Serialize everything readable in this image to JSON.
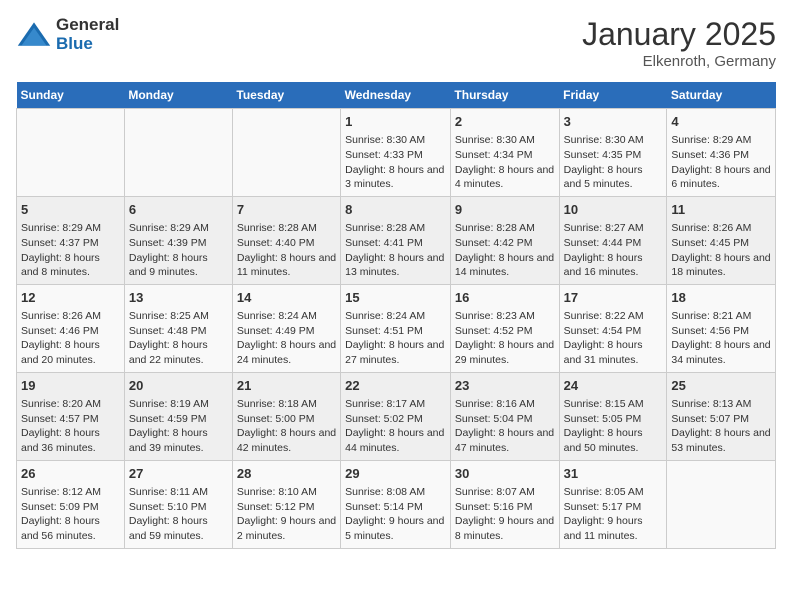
{
  "logo": {
    "general": "General",
    "blue": "Blue"
  },
  "title": "January 2025",
  "subtitle": "Elkenroth, Germany",
  "headers": [
    "Sunday",
    "Monday",
    "Tuesday",
    "Wednesday",
    "Thursday",
    "Friday",
    "Saturday"
  ],
  "rows": [
    [
      {
        "day": "",
        "content": ""
      },
      {
        "day": "",
        "content": ""
      },
      {
        "day": "",
        "content": ""
      },
      {
        "day": "1",
        "content": "Sunrise: 8:30 AM\nSunset: 4:33 PM\nDaylight: 8 hours and 3 minutes."
      },
      {
        "day": "2",
        "content": "Sunrise: 8:30 AM\nSunset: 4:34 PM\nDaylight: 8 hours and 4 minutes."
      },
      {
        "day": "3",
        "content": "Sunrise: 8:30 AM\nSunset: 4:35 PM\nDaylight: 8 hours and 5 minutes."
      },
      {
        "day": "4",
        "content": "Sunrise: 8:29 AM\nSunset: 4:36 PM\nDaylight: 8 hours and 6 minutes."
      }
    ],
    [
      {
        "day": "5",
        "content": "Sunrise: 8:29 AM\nSunset: 4:37 PM\nDaylight: 8 hours and 8 minutes."
      },
      {
        "day": "6",
        "content": "Sunrise: 8:29 AM\nSunset: 4:39 PM\nDaylight: 8 hours and 9 minutes."
      },
      {
        "day": "7",
        "content": "Sunrise: 8:28 AM\nSunset: 4:40 PM\nDaylight: 8 hours and 11 minutes."
      },
      {
        "day": "8",
        "content": "Sunrise: 8:28 AM\nSunset: 4:41 PM\nDaylight: 8 hours and 13 minutes."
      },
      {
        "day": "9",
        "content": "Sunrise: 8:28 AM\nSunset: 4:42 PM\nDaylight: 8 hours and 14 minutes."
      },
      {
        "day": "10",
        "content": "Sunrise: 8:27 AM\nSunset: 4:44 PM\nDaylight: 8 hours and 16 minutes."
      },
      {
        "day": "11",
        "content": "Sunrise: 8:26 AM\nSunset: 4:45 PM\nDaylight: 8 hours and 18 minutes."
      }
    ],
    [
      {
        "day": "12",
        "content": "Sunrise: 8:26 AM\nSunset: 4:46 PM\nDaylight: 8 hours and 20 minutes."
      },
      {
        "day": "13",
        "content": "Sunrise: 8:25 AM\nSunset: 4:48 PM\nDaylight: 8 hours and 22 minutes."
      },
      {
        "day": "14",
        "content": "Sunrise: 8:24 AM\nSunset: 4:49 PM\nDaylight: 8 hours and 24 minutes."
      },
      {
        "day": "15",
        "content": "Sunrise: 8:24 AM\nSunset: 4:51 PM\nDaylight: 8 hours and 27 minutes."
      },
      {
        "day": "16",
        "content": "Sunrise: 8:23 AM\nSunset: 4:52 PM\nDaylight: 8 hours and 29 minutes."
      },
      {
        "day": "17",
        "content": "Sunrise: 8:22 AM\nSunset: 4:54 PM\nDaylight: 8 hours and 31 minutes."
      },
      {
        "day": "18",
        "content": "Sunrise: 8:21 AM\nSunset: 4:56 PM\nDaylight: 8 hours and 34 minutes."
      }
    ],
    [
      {
        "day": "19",
        "content": "Sunrise: 8:20 AM\nSunset: 4:57 PM\nDaylight: 8 hours and 36 minutes."
      },
      {
        "day": "20",
        "content": "Sunrise: 8:19 AM\nSunset: 4:59 PM\nDaylight: 8 hours and 39 minutes."
      },
      {
        "day": "21",
        "content": "Sunrise: 8:18 AM\nSunset: 5:00 PM\nDaylight: 8 hours and 42 minutes."
      },
      {
        "day": "22",
        "content": "Sunrise: 8:17 AM\nSunset: 5:02 PM\nDaylight: 8 hours and 44 minutes."
      },
      {
        "day": "23",
        "content": "Sunrise: 8:16 AM\nSunset: 5:04 PM\nDaylight: 8 hours and 47 minutes."
      },
      {
        "day": "24",
        "content": "Sunrise: 8:15 AM\nSunset: 5:05 PM\nDaylight: 8 hours and 50 minutes."
      },
      {
        "day": "25",
        "content": "Sunrise: 8:13 AM\nSunset: 5:07 PM\nDaylight: 8 hours and 53 minutes."
      }
    ],
    [
      {
        "day": "26",
        "content": "Sunrise: 8:12 AM\nSunset: 5:09 PM\nDaylight: 8 hours and 56 minutes."
      },
      {
        "day": "27",
        "content": "Sunrise: 8:11 AM\nSunset: 5:10 PM\nDaylight: 8 hours and 59 minutes."
      },
      {
        "day": "28",
        "content": "Sunrise: 8:10 AM\nSunset: 5:12 PM\nDaylight: 9 hours and 2 minutes."
      },
      {
        "day": "29",
        "content": "Sunrise: 8:08 AM\nSunset: 5:14 PM\nDaylight: 9 hours and 5 minutes."
      },
      {
        "day": "30",
        "content": "Sunrise: 8:07 AM\nSunset: 5:16 PM\nDaylight: 9 hours and 8 minutes."
      },
      {
        "day": "31",
        "content": "Sunrise: 8:05 AM\nSunset: 5:17 PM\nDaylight: 9 hours and 11 minutes."
      },
      {
        "day": "",
        "content": ""
      }
    ]
  ]
}
